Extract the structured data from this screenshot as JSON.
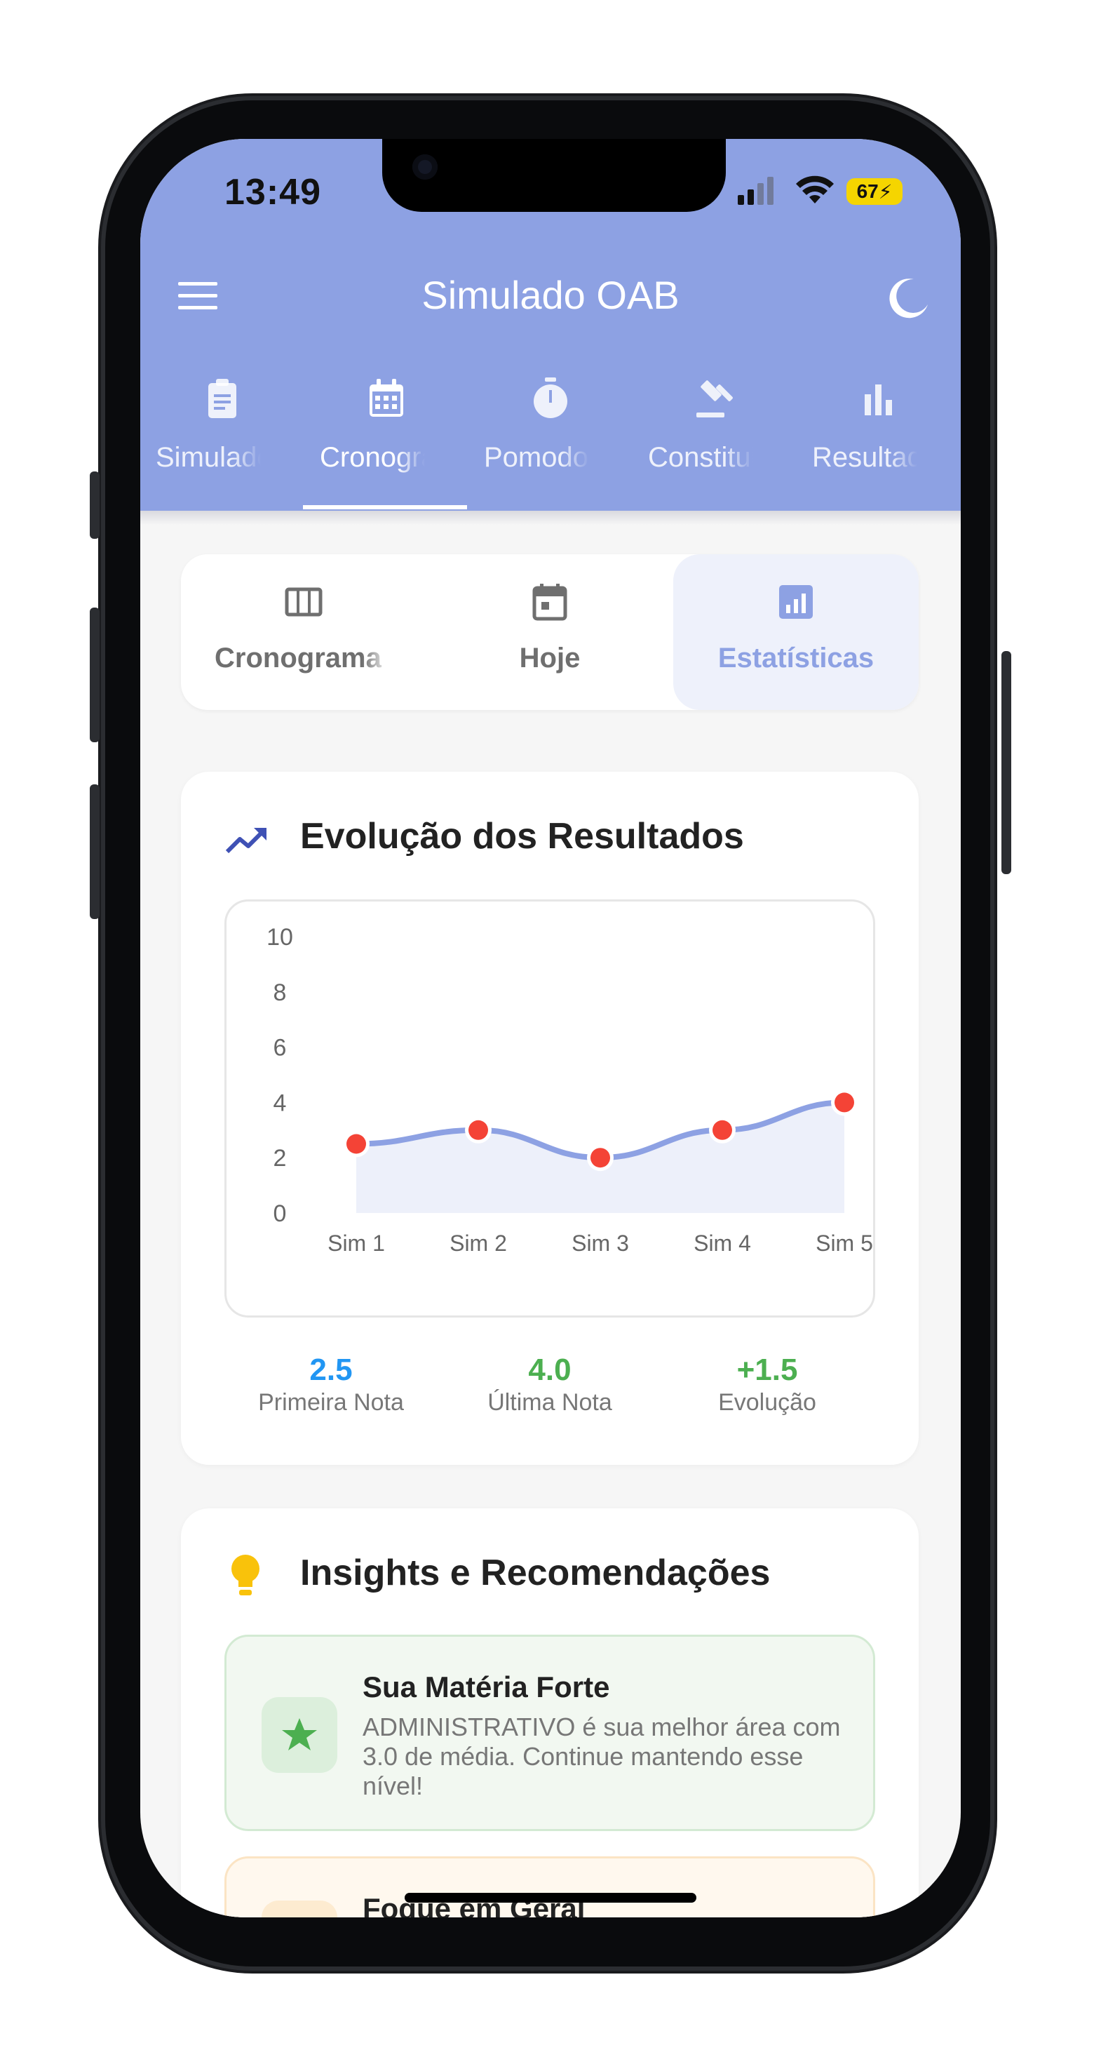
{
  "status_bar": {
    "time": "13:49",
    "battery": "67"
  },
  "app": {
    "title": "Simulado OAB"
  },
  "tabs": [
    {
      "label": "Simulados",
      "icon": "clipboard-icon"
    },
    {
      "label": "Cronograma",
      "icon": "calendar-icon"
    },
    {
      "label": "Pomodoro",
      "icon": "timer-icon"
    },
    {
      "label": "Constituição",
      "icon": "gavel-icon"
    },
    {
      "label": "Resultados",
      "icon": "bar-chart-icon"
    }
  ],
  "active_tab": 1,
  "segments": [
    {
      "label": "Cronograma",
      "icon": "grid-columns-icon"
    },
    {
      "label": "Hoje",
      "icon": "calendar-today-icon"
    },
    {
      "label": "Estatísticas",
      "icon": "stats-icon"
    }
  ],
  "active_segment": 2,
  "evolution": {
    "title": "Evolução dos Resultados",
    "stats": [
      {
        "value": "2.5",
        "label": "Primeira Nota",
        "color": "#2196f3"
      },
      {
        "value": "4.0",
        "label": "Última Nota",
        "color": "#4caf50"
      },
      {
        "value": "+1.5",
        "label": "Evolução",
        "color": "#4caf50"
      }
    ]
  },
  "chart_data": {
    "type": "area",
    "categories": [
      "Sim 1",
      "Sim 2",
      "Sim 3",
      "Sim 4",
      "Sim 5"
    ],
    "values": [
      2.5,
      3.0,
      2.0,
      3.0,
      4.0
    ],
    "ylim": [
      0,
      10
    ],
    "yticks": [
      "0",
      "2",
      "4",
      "6",
      "8",
      "10"
    ],
    "title": "",
    "xlabel": "",
    "ylabel": "",
    "line_color": "#8da1e3",
    "point_color": "#f44336",
    "fill_color": "#edf0fa",
    "grid": false
  },
  "insights": {
    "title": "Insights e Recomendações",
    "items": [
      {
        "title": "Sua Matéria Forte",
        "text": "ADMINISTRATIVO é sua melhor área com 3.0 de média. Continue mantendo esse nível!",
        "icon": "star-icon"
      },
      {
        "title": "Foque em Geral",
        "text": "",
        "icon": "warning-icon"
      }
    ]
  }
}
